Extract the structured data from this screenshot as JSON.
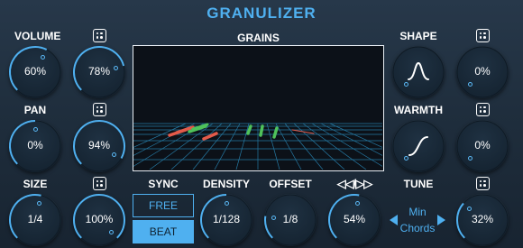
{
  "title": "GRANULIZER",
  "colors": {
    "accent": "#4fb0f0",
    "background": "#1f2e3d",
    "grain_red": "#e35a4a",
    "grain_green": "#4fc25a",
    "grid": "#2a8cbc"
  },
  "volume": {
    "label": "VOLUME",
    "value_a": "60%",
    "value_b": "78%",
    "level_a": 0.6,
    "level_b": 0.78
  },
  "pan": {
    "label": "PAN",
    "value_a": "0%",
    "value_b": "94%",
    "level_a": 0.5,
    "level_b": 0.94
  },
  "size": {
    "label": "SIZE",
    "value_a": "1/4",
    "value_b": "100%",
    "level_a": 0.55,
    "level_b": 1.0
  },
  "grains": {
    "label": "GRAINS"
  },
  "sync": {
    "label": "SYNC",
    "options": [
      "FREE",
      "BEAT"
    ],
    "selected": "BEAT"
  },
  "density": {
    "label": "DENSITY",
    "value": "1/128",
    "level": 0.5
  },
  "offset": {
    "label": "OFFSET",
    "value": "1/8",
    "level": 0.2
  },
  "direction": {
    "label": "◁◁/▷▷",
    "value": "54%",
    "level": 0.54
  },
  "shape": {
    "label": "SHAPE",
    "value": "0%",
    "level": 0.0,
    "icon": "bell-curve-icon"
  },
  "warmth": {
    "label": "WARMTH",
    "value": "0%",
    "level": 0.0,
    "icon": "s-curve-icon"
  },
  "tune": {
    "label": "TUNE",
    "scale": "Min",
    "mode": "Chords",
    "value": "32%",
    "level": 0.32
  },
  "icons": {
    "randomize": "dice-icon"
  }
}
